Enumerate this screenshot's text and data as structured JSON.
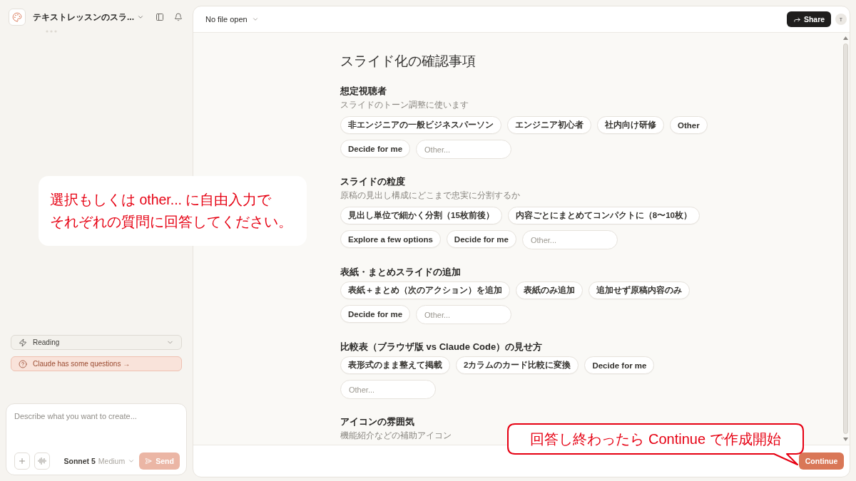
{
  "sidebar": {
    "title": "テキストレッスンのスラ...",
    "status_rows": [
      {
        "kind": "dropdown",
        "label": "Reading"
      },
      {
        "kind": "alert",
        "label": "Claude has some questions →"
      }
    ],
    "composer": {
      "placeholder": "Describe what you want to create...",
      "model": "Sonnet 5",
      "effort": "Medium",
      "send": {
        "label": "Send",
        "disabled": true
      }
    }
  },
  "main": {
    "file_menu": "No file open",
    "share": "Share",
    "avatar": "T",
    "title": "スライド化の確認事項",
    "questions": [
      {
        "title": "想定視聴者",
        "subtitle": "スライドのトーン調整に使います",
        "options": [
          {
            "label": "非エンジニアの一般ビジネスパーソン",
            "selected": false
          },
          {
            "label": "エンジニア初心者",
            "selected": false
          },
          {
            "label": "社内向け研修",
            "selected": false
          },
          {
            "label": "Other",
            "selected": false
          },
          {
            "label": "Decide for me",
            "selected": false
          }
        ],
        "other_placeholder": "Other..."
      },
      {
        "title": "スライドの粒度",
        "subtitle": "原稿の見出し構成にどこまで忠実に分割するか",
        "options": [
          {
            "label": "見出し単位で細かく分割（15枚前後）",
            "selected": false
          },
          {
            "label": "内容ごとにまとめてコンパクトに（8〜10枚）",
            "selected": false
          },
          {
            "label": "Explore a few options",
            "selected": false
          },
          {
            "label": "Decide for me",
            "selected": false
          }
        ],
        "other_placeholder": "Other..."
      },
      {
        "title": "表紙・まとめスライドの追加",
        "options": [
          {
            "label": "表紙＋まとめ（次のアクション）を追加",
            "selected": false
          },
          {
            "label": "表紙のみ追加",
            "selected": false
          },
          {
            "label": "追加せず原稿内容のみ",
            "selected": false
          },
          {
            "label": "Decide for me",
            "selected": false
          }
        ],
        "other_placeholder": "Other..."
      },
      {
        "title": "比較表（ブラウザ版 vs Claude Code）の見せ方",
        "options": [
          {
            "label": "表形式のまま整えて掲載",
            "selected": false
          },
          {
            "label": "2カラムのカード比較に変換",
            "selected": false
          },
          {
            "label": "Decide for me",
            "selected": false
          }
        ],
        "other_placeholder": "Other..."
      },
      {
        "title": "アイコンの雰囲気",
        "subtitle": "機能紹介などの補助アイコン"
      }
    ],
    "continue": "Continue"
  },
  "annotations": [
    {
      "kind": "note",
      "lines": [
        "選択もしくは other... に自由入力で",
        "それぞれの質問に回答してください。"
      ]
    },
    {
      "kind": "bubble",
      "lines": [
        "回答し終わったら Continue で作成開始"
      ]
    }
  ]
}
